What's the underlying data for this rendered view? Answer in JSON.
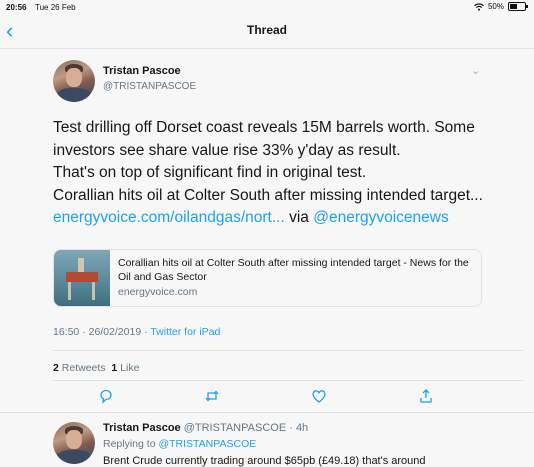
{
  "status_bar": {
    "time": "20:56",
    "date": "Tue 26 Feb",
    "battery": "50%"
  },
  "nav": {
    "title": "Thread"
  },
  "tweet": {
    "author_name": "Tristan Pascoe",
    "author_handle": "@TRISTANPASCOE",
    "lines": [
      "Test drilling off Dorset coast reveals 15M barrels worth. Some",
      "investors see share value rise 33% y'day as result.",
      "That's on top of significant find in original test.",
      "Corallian hits oil at Colter South after missing intended target..."
    ],
    "link_text": "energyvoice.com/oilandgas/nort...",
    "via_text": "via",
    "via_handle": "@energyvoicenews",
    "card": {
      "title": "Corallian hits oil at Colter South after missing intended target - News for the Oil and Gas Sector",
      "domain": "energyvoice.com"
    },
    "timestamp": "16:50 · 26/02/2019",
    "source_sep": "·",
    "source": "Twitter for iPad",
    "retweets_count": "2",
    "retweets_label": "Retweets",
    "likes_count": "1",
    "likes_label": "Like"
  },
  "reply": {
    "author_name": "Tristan Pascoe",
    "author_handle": "@TRISTANPASCOE",
    "age": "· 4h",
    "replying_to_label": "Replying to",
    "replying_to_handle": "@TRISTANPASCOE",
    "partial_text": "Brent Crude currently trading around $65pb (£49.18) that's around"
  },
  "icons": [
    "back-chevron-icon",
    "wifi-icon",
    "battery-icon",
    "chevron-down-icon",
    "reply-icon",
    "retweet-icon",
    "like-icon",
    "share-icon"
  ],
  "colors": {
    "accent": "#1da1f2",
    "text": "#14171a",
    "muted": "#657786",
    "background": "#f7f7f7"
  }
}
